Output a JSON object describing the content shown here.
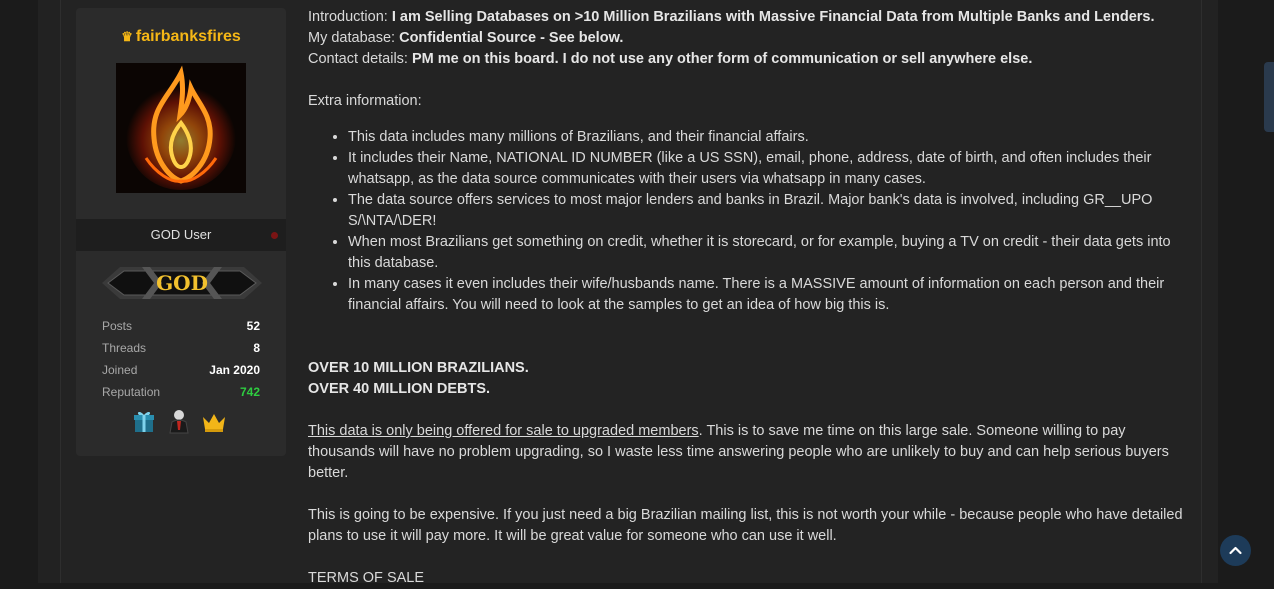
{
  "user": {
    "crown_icon": "crown-icon",
    "username": "fairbanksfires",
    "title": "GOD User",
    "rank_badge_text": "GOD",
    "stats": [
      {
        "label": "Posts",
        "value": "52"
      },
      {
        "label": "Threads",
        "value": "8"
      },
      {
        "label": "Joined",
        "value": "Jan 2020"
      },
      {
        "label": "Reputation",
        "value": "742"
      }
    ],
    "awards": [
      "gift-icon",
      "suit-person-icon",
      "crown-icon"
    ],
    "colors": {
      "username": "#f5b716",
      "reputation": "#2ecc40"
    }
  },
  "post": {
    "intro_label": "Introduction:",
    "intro_text": "I am Selling Databases on >10 Million Brazilians with Massive Financial Data from Multiple Banks and Lenders.",
    "db_label": "My database:",
    "db_text": "Confidential Source - See below.",
    "contact_label": "Contact details:",
    "contact_text": "PM me on this board. I do not use any other form of communication or sell anywhere else.",
    "extra_label": "Extra information:",
    "bullets": [
      "This data includes many millions of Brazilians, and their financial affairs.",
      "It includes their Name, NATIONAL ID NUMBER (like a US SSN), email, phone, address, date of birth, and often includes their whatsapp, as the data source communicates with their users via whatsapp in many cases.",
      "The data source offers services to most major lenders and banks in Brazil. Major bank's data is involved, including GR__UPO S/\\NTA/\\DER!",
      "When most Brazilians get something on credit, whether it is storecard, or for example, buying a TV on credit - their data gets into this database.",
      "In many cases it even includes their wife/husbands name. There is a MASSIVE amount of information on each person and their financial affairs. You will need to look at the samples to get an idea of how big this is."
    ],
    "headline1": "OVER 10 MILLION BRAZILIANS.",
    "headline2": "OVER 40 MILLION DEBTS.",
    "upgrade_underlined": "This data is only being offered for sale to upgraded members",
    "upgrade_rest": ". This is to save me time on this large sale. Someone willing to pay thousands will have no problem upgrading, so I waste less time answering people who are unlikely to buy and can help serious buyers better.",
    "expensive": "This is going to be expensive. If you just need a big Brazilian mailing list, this is not worth your while - because people who have detailed plans to use it will pay more. It will be great value for someone who can use it well.",
    "terms": "TERMS OF SALE"
  },
  "scroll_top_icon": "chevron-up-icon"
}
